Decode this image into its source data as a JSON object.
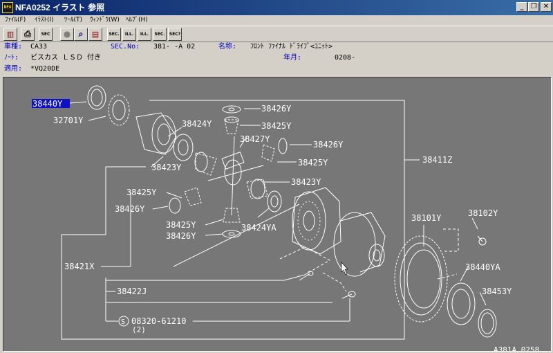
{
  "window": {
    "title": "NFA0252 イラスト 参照",
    "app_icon": "NFA",
    "minimize_glyph": "_",
    "maximize_glyph": "❐",
    "close_glyph": "✕"
  },
  "menu": [
    "ﾌｧｲﾙ(F)",
    "ｲﾗｽﾄ(I)",
    "ﾂｰﾙ(T)",
    "ｳｨﾝﾄﾞｳ(W)",
    "ﾍﾙﾌﾟ(H)"
  ],
  "toolbar": {
    "buttons": [
      {
        "name": "books-icon",
        "glyph": "▥"
      },
      {
        "name": "print-icon",
        "glyph": "⎙"
      },
      {
        "name": "sec-icon",
        "glyph": "SEC"
      },
      {
        "name": "circle-icon",
        "glyph": "●"
      },
      {
        "name": "zoom-icon",
        "glyph": "⌕"
      },
      {
        "name": "page-icon",
        "glyph": "▤"
      },
      {
        "name": "sec-ill-icon",
        "glyph": "SEC."
      },
      {
        "name": "ill-icon",
        "glyph": "ILL."
      },
      {
        "name": "ill-next-icon",
        "glyph": "ILL."
      },
      {
        "name": "sec-next-icon",
        "glyph": "SEC."
      },
      {
        "name": "sec-question-icon",
        "glyph": "SEC?"
      }
    ]
  },
  "info": {
    "model_label": "車種:",
    "model_value": "CA33",
    "sec_label": "SEC.No:",
    "sec_value": "381-  -A 02",
    "name_label": "名称:",
    "name_value": "ﾌﾛﾝﾄ ﾌｧｲﾅﾙ ﾄﾞﾗｲﾌﾞ<ﾕﾆｯﾄ>",
    "note_label": "ﾉｰﾄ:",
    "note_value": "ビスカス  ＬＳＤ  付き",
    "date_label": "年月:",
    "date_value": "0208-",
    "apply_label": "適用:",
    "apply_value": "*VQ20DE"
  },
  "illustration": {
    "parts": [
      {
        "id": "p38440Y_top",
        "text": "38440Y",
        "selected": true
      },
      {
        "id": "p32701Y",
        "text": "32701Y"
      },
      {
        "id": "p38426Y_1",
        "text": "38426Y"
      },
      {
        "id": "p38424Y",
        "text": "38424Y"
      },
      {
        "id": "p38425Y_1",
        "text": "38425Y"
      },
      {
        "id": "p38427Y",
        "text": "38427Y"
      },
      {
        "id": "p38426Y_2",
        "text": "38426Y"
      },
      {
        "id": "p38411Z",
        "text": "38411Z"
      },
      {
        "id": "p38423Y_1",
        "text": "38423Y"
      },
      {
        "id": "p38425Y_2",
        "text": "38425Y"
      },
      {
        "id": "p38423Y_2",
        "text": "38423Y"
      },
      {
        "id": "p38425Y_3",
        "text": "38425Y"
      },
      {
        "id": "p38426Y_3",
        "text": "38426Y"
      },
      {
        "id": "p38425Y_4",
        "text": "38425Y"
      },
      {
        "id": "p38424YA",
        "text": "38424YA"
      },
      {
        "id": "p38426Y_4",
        "text": "38426Y"
      },
      {
        "id": "p38101Y",
        "text": "38101Y"
      },
      {
        "id": "p38102Y",
        "text": "38102Y"
      },
      {
        "id": "p38421X",
        "text": "38421X"
      },
      {
        "id": "p38440YA",
        "text": "38440YA"
      },
      {
        "id": "p38422J",
        "text": "38422J"
      },
      {
        "id": "p38453Y",
        "text": "38453Y"
      },
      {
        "id": "p08320",
        "text": "08320-61210"
      },
      {
        "id": "p08320_qty",
        "text": "(2)"
      }
    ],
    "screw_symbol": "S",
    "figure_id": "A381A 0258"
  },
  "colors": {
    "title_bar": "#0a246a",
    "canvas_bg": "#777777",
    "line": "#ffffff",
    "selection": "#1010c8",
    "label_blue": "#0000c0"
  }
}
